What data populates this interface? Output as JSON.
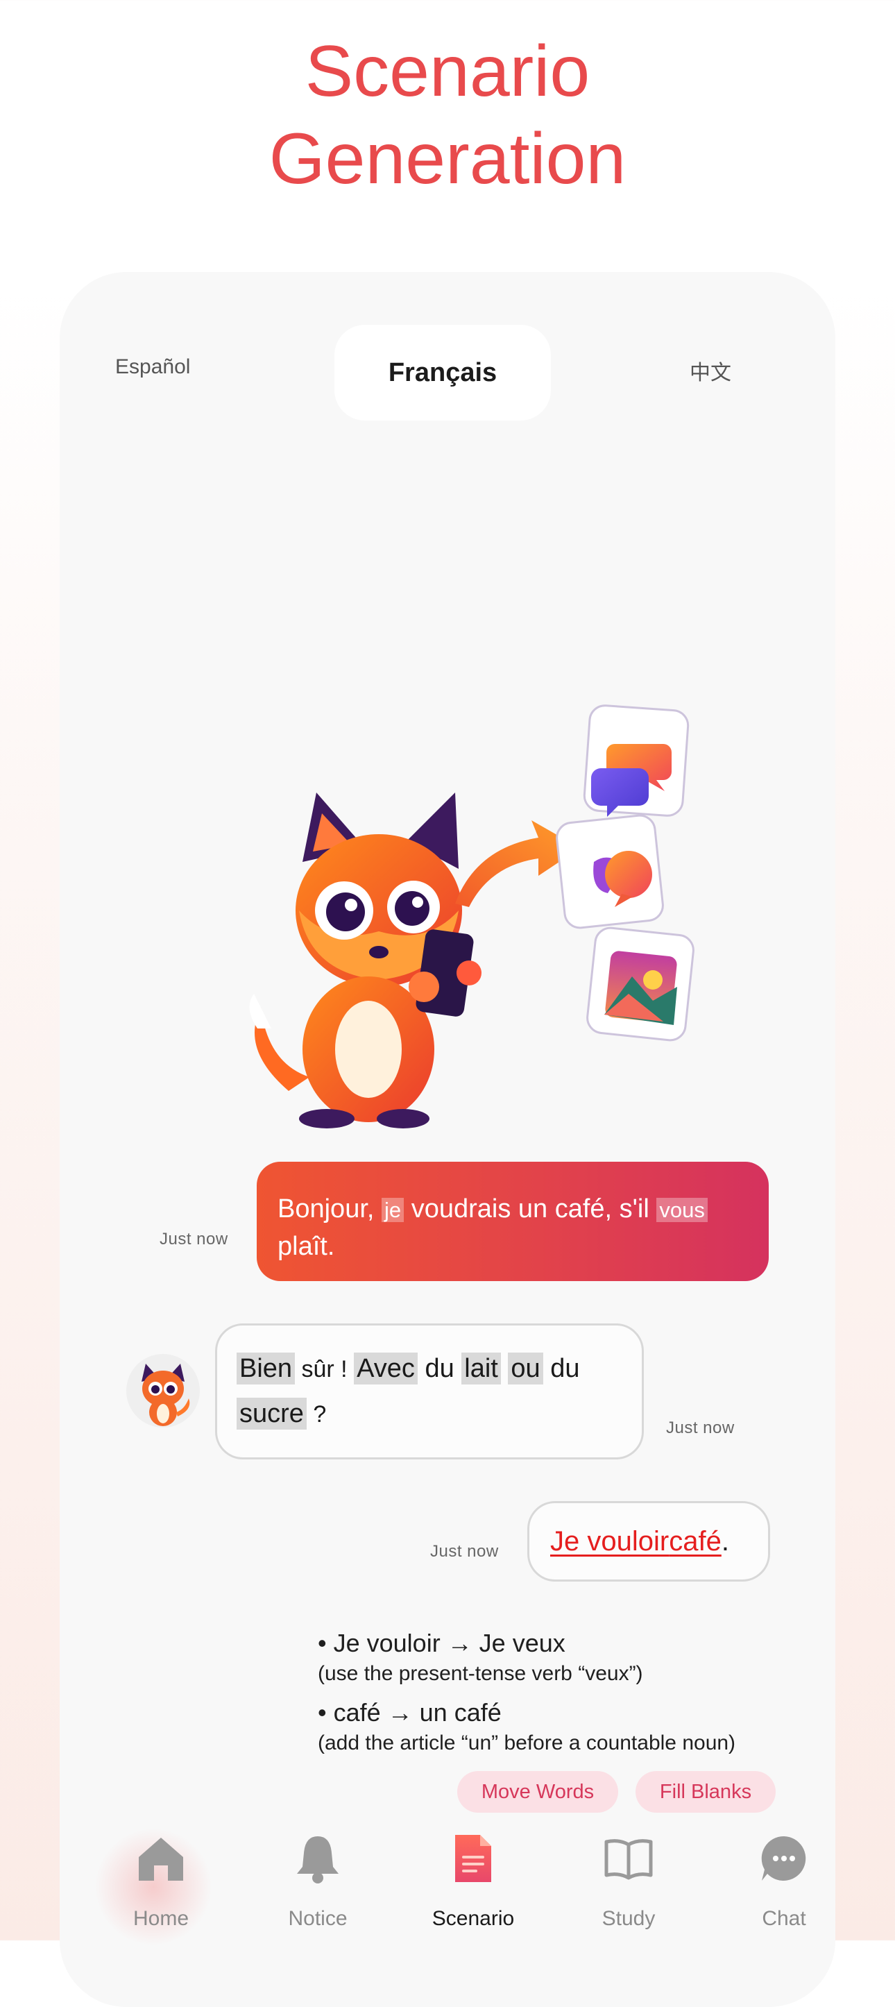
{
  "headline": {
    "line1": "Scenario",
    "line2": "Generation"
  },
  "languages": {
    "left": "Español",
    "selected": "Français",
    "right": "中文"
  },
  "chat": {
    "user_message": {
      "time": "Just now",
      "part1": "Bonjour, ",
      "hl1": "je",
      "part2": " voudrais un café, s'il ",
      "hl2": "vous",
      "part3": " plaît."
    },
    "bot_message": {
      "time": "Just now",
      "w1": "Bien",
      "t1": " sûr ! ",
      "w2": "Avec",
      "t2": " du ",
      "w3": "lait",
      "t3": " ",
      "w4": "ou",
      "t4": " du ",
      "w5": "sucre",
      "t5": " ?"
    },
    "correction_message": {
      "time": "Just now",
      "err1": "Je vouloir",
      "space": " ",
      "err2": "café",
      "end": "."
    },
    "feedback": [
      {
        "main": "• Je vouloir → Je veux",
        "detail": "(use the present-tense verb “veux”)"
      },
      {
        "main": "• café → un café",
        "detail": "(add the article “un” before a countable noun)"
      }
    ],
    "chips": {
      "move": "Move Words",
      "fill": "Fill Blanks"
    }
  },
  "tabbar": {
    "home": "Home",
    "notice": "Notice",
    "scenario": "Scenario",
    "study": "Study",
    "chat": "Chat"
  },
  "colors": {
    "brand": "#e84a4c",
    "bubble_gradient_start": "#ef5532",
    "bubble_gradient_end": "#d5325e",
    "error_red": "#e51e1e",
    "chip_bg": "#fbe0e5",
    "chip_text": "#d6375a"
  },
  "icons": [
    "home-icon",
    "bell-icon",
    "document-icon",
    "book-icon",
    "chat-dots-icon",
    "fox-mascot",
    "chat-bubbles-icon",
    "photo-icon"
  ]
}
